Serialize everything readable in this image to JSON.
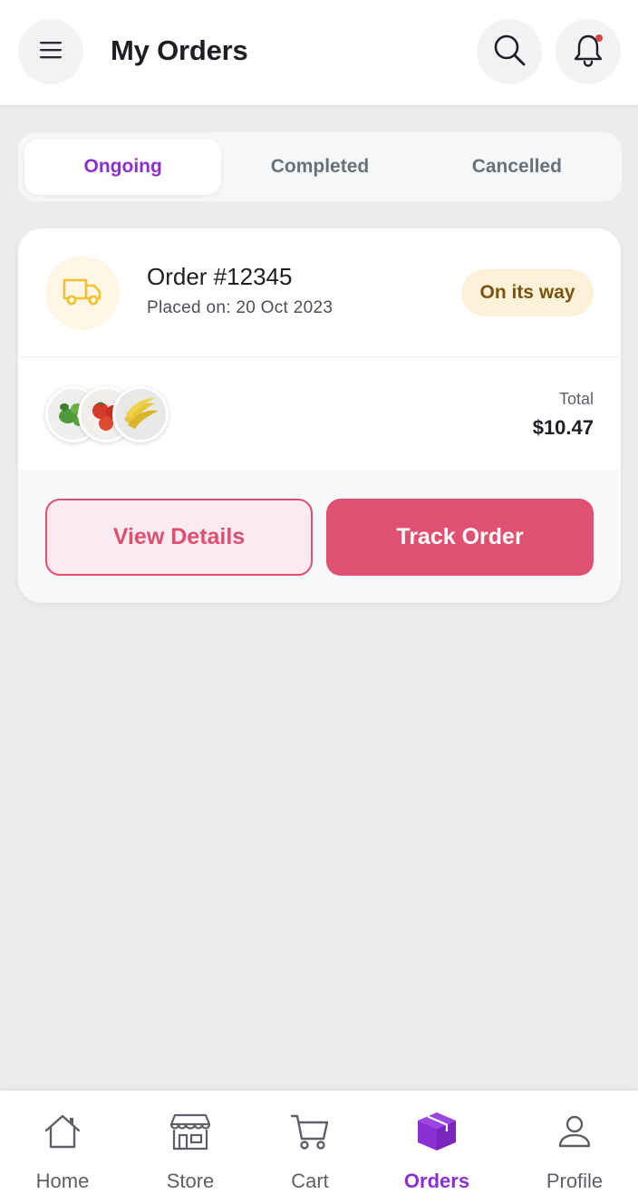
{
  "header": {
    "title": "My Orders",
    "menu_icon": "menu-icon",
    "search_icon": "search-icon",
    "notification_icon": "bell-icon",
    "has_unread_notifications": true
  },
  "tabs": [
    {
      "label": "Ongoing",
      "active": true
    },
    {
      "label": "Completed",
      "active": false
    },
    {
      "label": "Cancelled",
      "active": false
    }
  ],
  "order": {
    "id_label": "Order #12345",
    "placed_on": "Placed on: 20 Oct 2023",
    "status": "On its way",
    "status_icon": "truck-icon",
    "items": [
      {
        "image": "green-vegetables"
      },
      {
        "image": "tomatoes"
      },
      {
        "image": "bananas"
      }
    ],
    "total_label": "Total",
    "total_value": "$10.47",
    "view_details_label": "View Details",
    "track_order_label": "Track Order"
  },
  "nav": {
    "items": [
      {
        "label": "Home",
        "icon": "home-icon",
        "active": false
      },
      {
        "label": "Store",
        "icon": "store-icon",
        "active": false
      },
      {
        "label": "Cart",
        "icon": "cart-icon",
        "active": false
      },
      {
        "label": "Orders",
        "icon": "box-icon",
        "active": true
      },
      {
        "label": "Profile",
        "icon": "user-icon",
        "active": false
      }
    ]
  },
  "colors": {
    "accent_purple": "#8a2fd1",
    "primary_pink": "#e05072",
    "status_bg": "#fdf1d9",
    "status_text": "#7a5512",
    "truck_yellow": "#f2c12e"
  }
}
